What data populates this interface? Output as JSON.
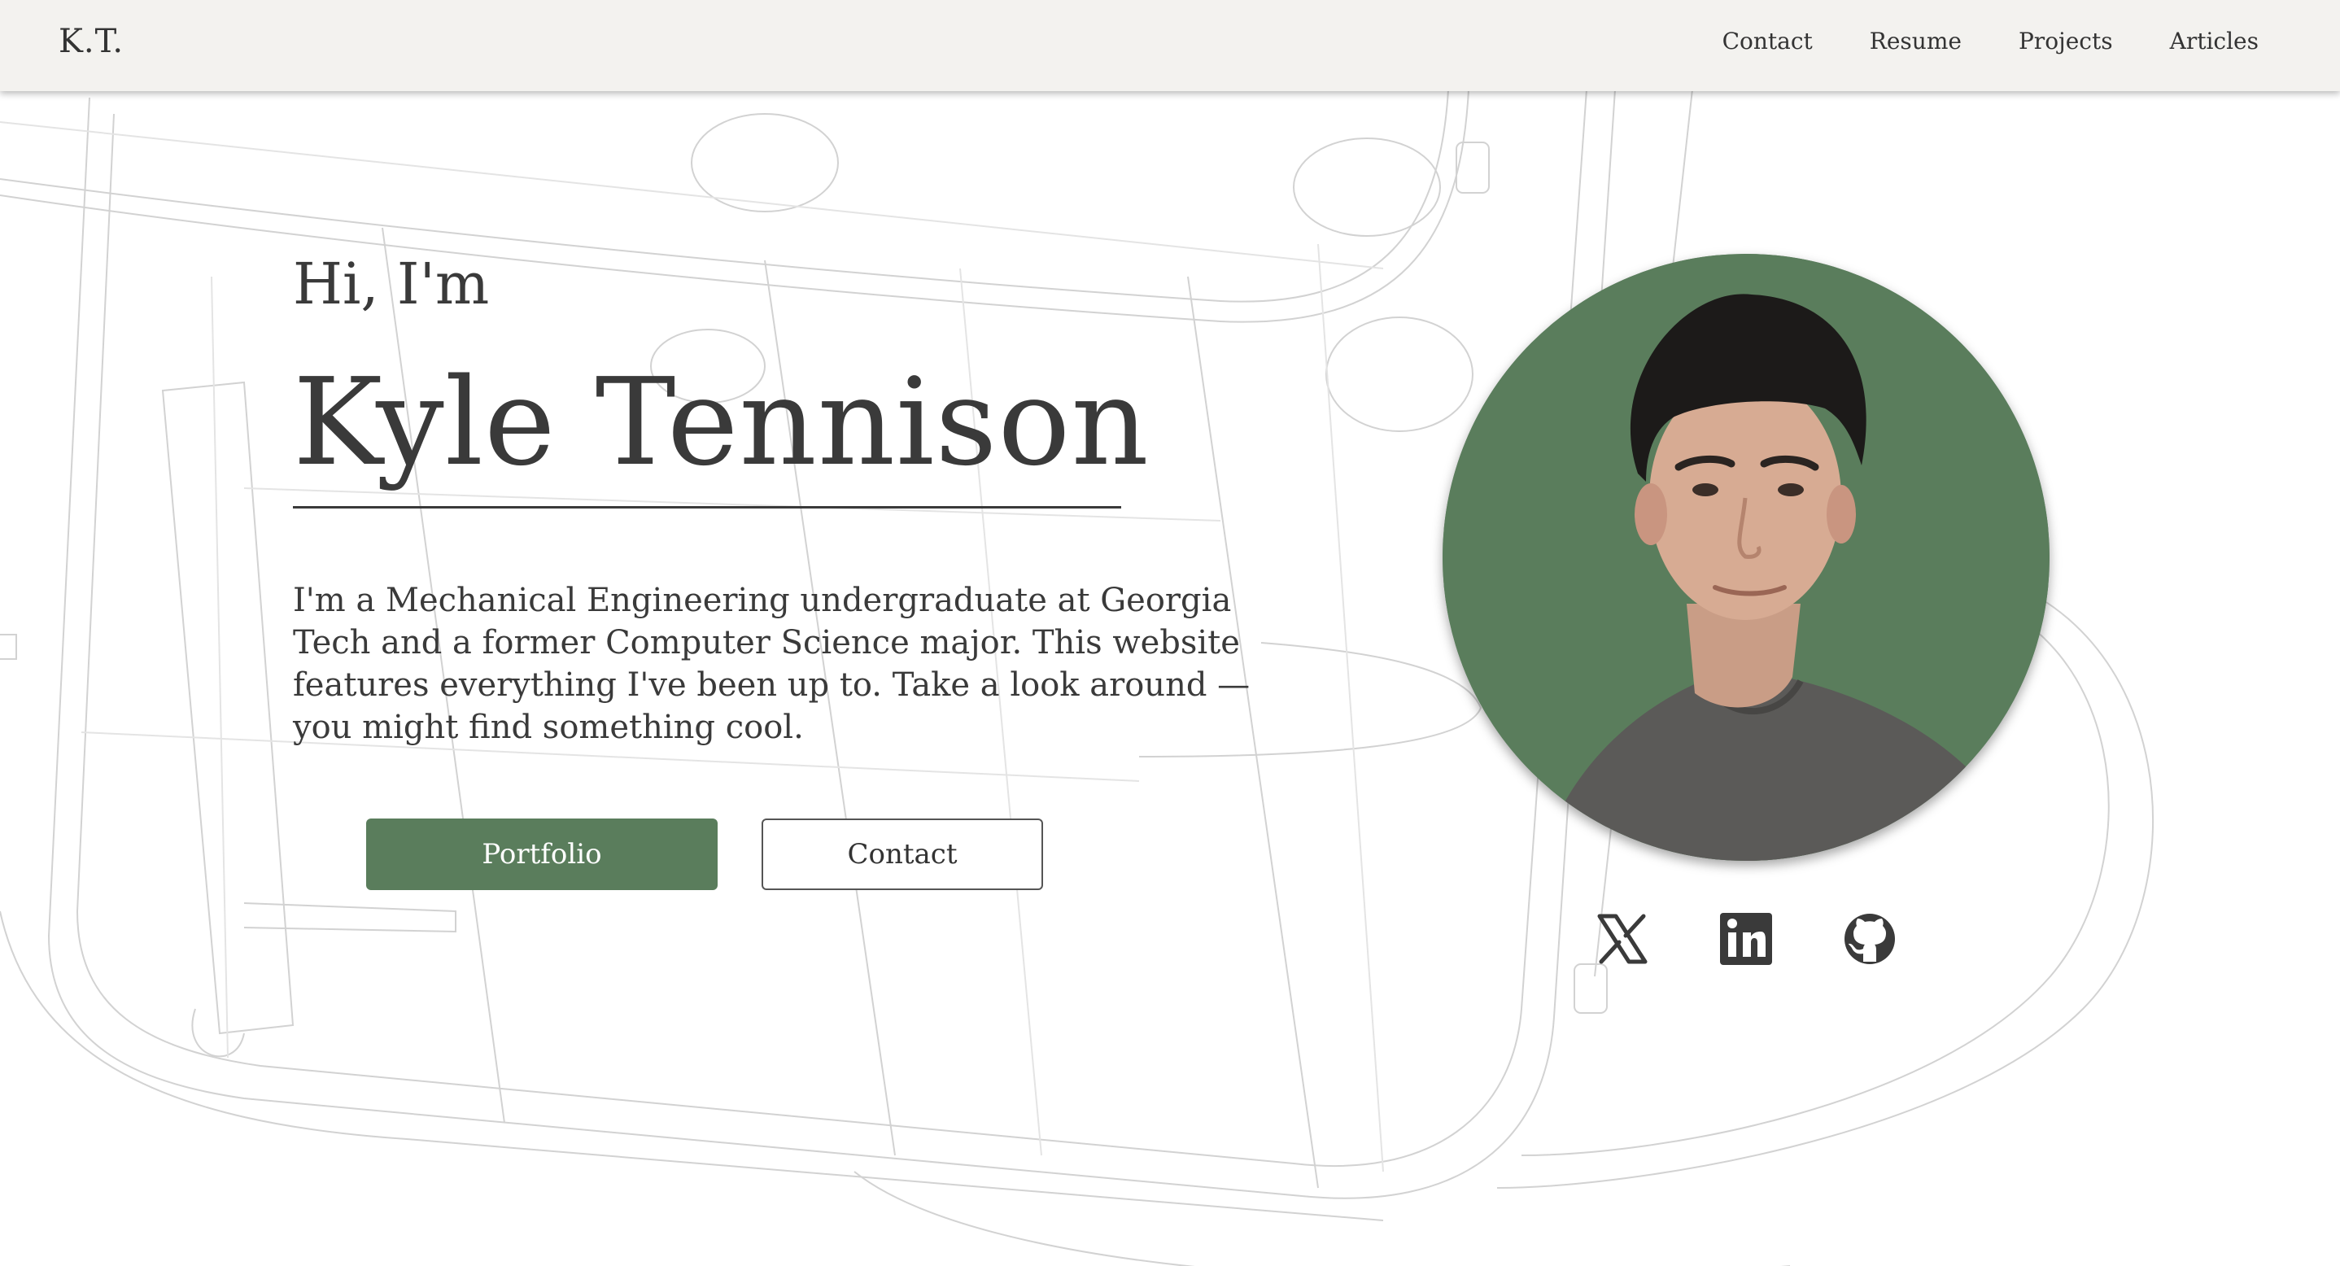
{
  "header": {
    "logo": "K.T.",
    "nav": [
      "Contact",
      "Resume",
      "Projects",
      "Articles"
    ]
  },
  "hero": {
    "greeting": "Hi, I'm",
    "name": "Kyle Tennison",
    "intro": "I'm a Mechanical Engineering undergraduate at Georgia Tech and a former Computer Science major. This website features everything I've been up to. Take a look around — you might find something cool.",
    "buttons": {
      "primary": "Portfolio",
      "secondary": "Contact"
    }
  },
  "social": {
    "icons": [
      "x-icon",
      "linkedin-icon",
      "github-icon"
    ]
  },
  "colors": {
    "accent": "#5a7d5c",
    "header_bg": "#f3f2ef",
    "text": "#3a3a3a"
  }
}
